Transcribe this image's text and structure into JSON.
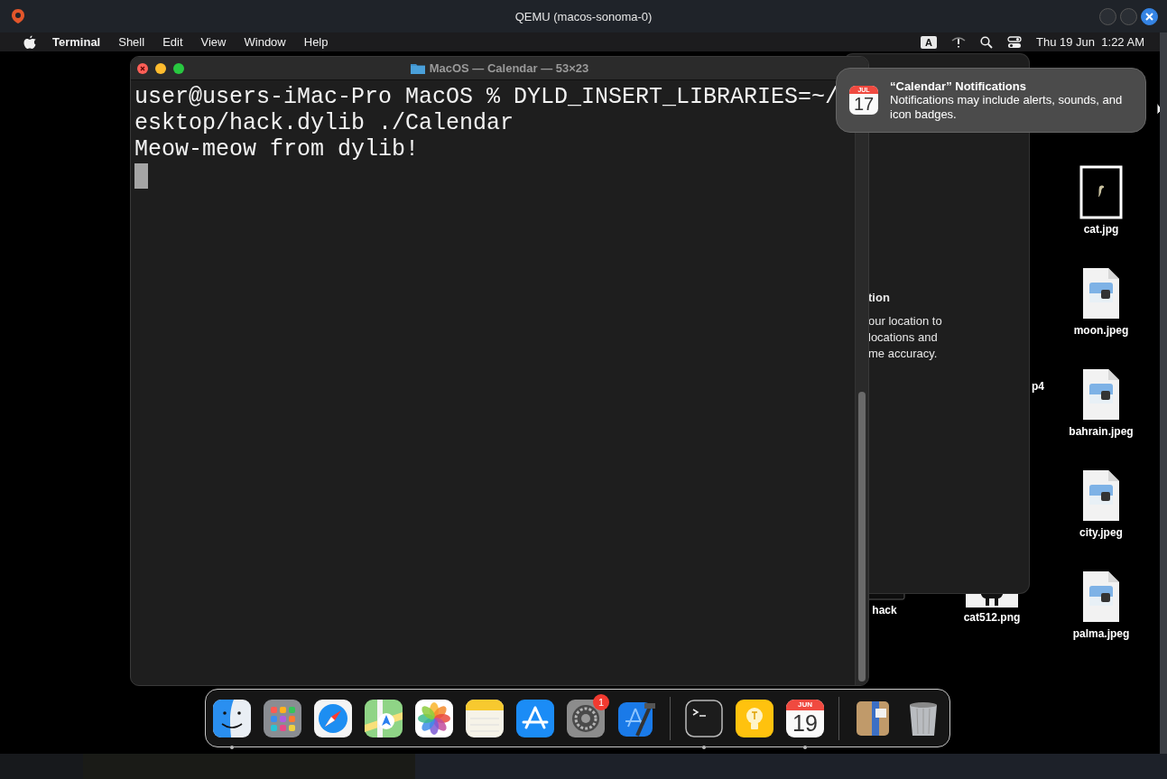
{
  "host_window": {
    "title": "QEMU (macos-sonoma-0)"
  },
  "menu_bar": {
    "app": "Terminal",
    "items": [
      "Shell",
      "Edit",
      "View",
      "Window",
      "Help"
    ],
    "input_source": "A",
    "clock": "Thu 19 Jun  1:22 AM"
  },
  "terminal": {
    "title": "MacOS — Calendar — 53×23",
    "lines": [
      "user@users-iMac-Pro MacOS % DYLD_INSERT_LIBRARIES=~/",
      "esktop/hack.dylib ./Calendar",
      "Meow-meow from dylib!"
    ]
  },
  "background_window": {
    "lines": [
      {
        "kind": "heading",
        "text": "tion"
      },
      {
        "kind": "body",
        "text": "our location to"
      },
      {
        "kind": "body",
        "text": "locations and"
      },
      {
        "kind": "body",
        "text": "me accuracy."
      }
    ]
  },
  "notification": {
    "title": "“Calendar” Notifications",
    "body": "Notifications may include alerts, sounds, and icon badges.",
    "icon_month": "JUL",
    "icon_day": "17"
  },
  "desktop_icons": [
    {
      "label": "cat.jpg",
      "kind": "photo"
    },
    {
      "label": "moon.jpeg",
      "kind": "jpeg"
    },
    {
      "label": "bahrain.jpeg",
      "kind": "jpeg"
    },
    {
      "label": "city.jpeg",
      "kind": "jpeg"
    },
    {
      "label": "palma.jpeg",
      "kind": "jpeg"
    },
    {
      "label": "p4",
      "kind": "none"
    },
    {
      "label": "cat512.png",
      "kind": "png"
    },
    {
      "label": "hack",
      "kind": "exec"
    }
  ],
  "dock": {
    "apps": [
      {
        "kind": "finder",
        "running": true
      },
      {
        "kind": "launchpad",
        "running": false
      },
      {
        "kind": "safari",
        "running": false
      },
      {
        "kind": "maps",
        "running": false
      },
      {
        "kind": "photos",
        "running": false
      },
      {
        "kind": "notes",
        "running": false
      },
      {
        "kind": "appstore",
        "running": false
      },
      {
        "kind": "settings",
        "running": false,
        "badge": "1"
      },
      {
        "kind": "xcode",
        "running": false
      },
      {
        "kind": "separator"
      },
      {
        "kind": "terminal",
        "running": true
      },
      {
        "kind": "tips",
        "running": false
      },
      {
        "kind": "calendar",
        "running": true,
        "month": "JUN",
        "day": "19"
      },
      {
        "kind": "separator"
      },
      {
        "kind": "archive",
        "running": false
      },
      {
        "kind": "trash",
        "running": false
      }
    ]
  }
}
